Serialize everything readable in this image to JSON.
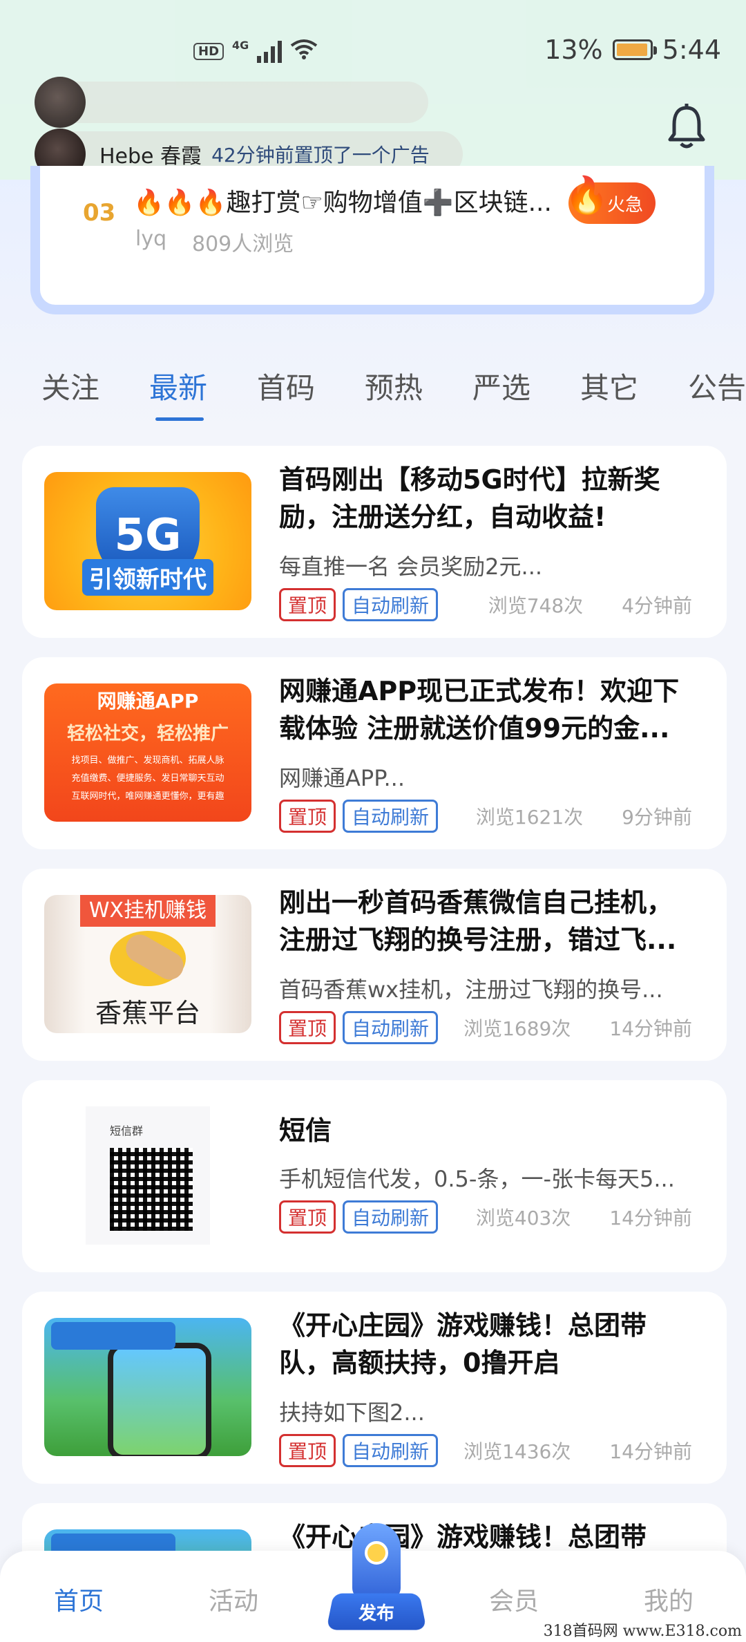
{
  "status_bar": {
    "network": "4G",
    "hd": "HD",
    "battery": "13%",
    "time": "5:44"
  },
  "notice": {
    "name": "Hebe 春霞",
    "message": "42分钟前置顶了一个广告"
  },
  "hot": {
    "rank": "03",
    "title": "🔥🔥🔥趣打赏☞购物增值➕区块链...",
    "author": "lyq",
    "views": "809人浏览",
    "badge": "火急"
  },
  "tabs": [
    "关注",
    "最新",
    "首码",
    "预热",
    "严选",
    "其它",
    "公告"
  ],
  "posts": [
    {
      "title": "首码刚出【移动5G时代】拉新奖励，注册送分红，自动收益!",
      "desc": "每直推一名 会员奖励2元...",
      "tag1": "置顶",
      "tag2": "自动刷新",
      "views": "浏览748次",
      "time": "4分钟前",
      "thumb_text": "5G",
      "thumb_caption": "引领新时代"
    },
    {
      "title": "网赚通APP现已正式发布！欢迎下载体验 注册就送价值99元的金...",
      "desc": "网赚通APP...",
      "tag1": "置顶",
      "tag2": "自动刷新",
      "views": "浏览1621次",
      "time": "9分钟前",
      "thumb_text": "网赚通APP",
      "thumb_caption": "轻松社交，轻松推广",
      "thumb_lines": "找项目、做推广、发现商机、拓展人脉\n充值缴费、便捷服务、发日常聊天互动\n互联网时代，唯网赚通更懂你，更有趣"
    },
    {
      "title": "刚出一秒首码香蕉微信自己挂机，注册过飞翔的换号注册，错过飞...",
      "desc": "首码香蕉wx挂机，注册过飞翔的换号...",
      "tag1": "置顶",
      "tag2": "自动刷新",
      "views": "浏览1689次",
      "time": "14分钟前",
      "thumb_text": "WX挂机赚钱",
      "thumb_caption": "香蕉平台"
    },
    {
      "title": "短信",
      "desc": "手机短信代发，0.5-条，一-张卡每天5...",
      "tag1": "置顶",
      "tag2": "自动刷新",
      "views": "浏览403次",
      "time": "14分钟前",
      "thumb_text": "短信群"
    },
    {
      "title": "《开心庄园》游戏赚钱！总团带队，高额扶持，0撸开启",
      "desc": "扶持如下图2...",
      "tag1": "置顶",
      "tag2": "自动刷新",
      "views": "浏览1436次",
      "time": "14分钟前"
    },
    {
      "title": "《开心庄园》游戏赚钱！总团带"
    }
  ],
  "nav": {
    "home": "首页",
    "activity": "活动",
    "publish": "发布",
    "member": "会员",
    "mine": "我的"
  },
  "watermark": "318首码网  www.E318.com",
  "colors": {
    "accent": "#2d74d6",
    "tag_red": "#d43030",
    "tag_blue": "#3e7bd6"
  }
}
